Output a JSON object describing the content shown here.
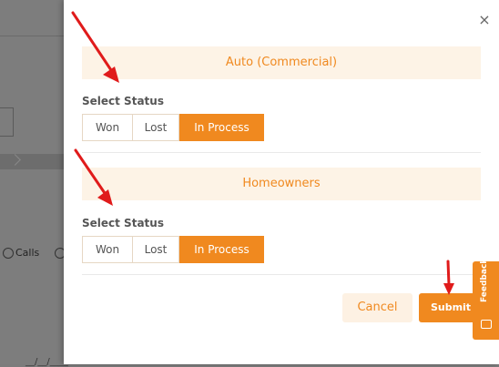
{
  "background": {
    "calls_label": "Calls",
    "date_fragment": "__/__/____"
  },
  "modal": {
    "close_glyph": "×",
    "sections": [
      {
        "title": "Auto (Commercial)",
        "status_label": "Select Status",
        "options": [
          "Won",
          "Lost",
          "In Process"
        ],
        "selected": "In Process"
      },
      {
        "title": "Homeowners",
        "status_label": "Select Status",
        "options": [
          "Won",
          "Lost",
          "In Process"
        ],
        "selected": "In Process"
      }
    ],
    "footer": {
      "cancel_label": "Cancel",
      "submit_label": "Submit"
    }
  },
  "feedback": {
    "label": "Feedback",
    "icon": "chat-icon"
  },
  "colors": {
    "accent": "#f0891f",
    "accent_light": "#fdf3e6",
    "overlay": "#7d7d7d",
    "annotation": "#e01b1b"
  }
}
